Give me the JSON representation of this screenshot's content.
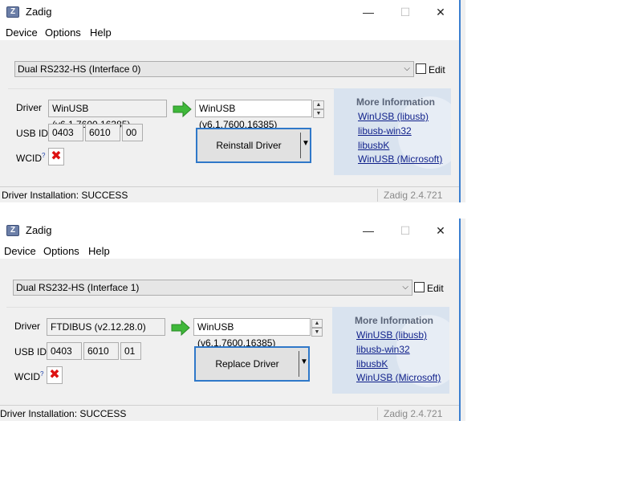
{
  "windows": [
    {
      "title": "Zadig",
      "app_icon_letter": "Z",
      "menu": [
        "Device",
        "Options",
        "Help"
      ],
      "device_selected": "Dual RS232-HS (Interface 0)",
      "edit_label": "Edit",
      "driver_label": "Driver",
      "current_driver": "WinUSB (v6.1.7600.16385)",
      "target_driver": "WinUSB (v6.1.7600.16385)",
      "usbid_label": "USB ID",
      "usb_id": [
        "0403",
        "6010",
        "00"
      ],
      "wcid_label": "WCID",
      "wcid_sup": "?",
      "action_button": "Reinstall Driver",
      "more_info_title": "More Information",
      "links": [
        "WinUSB (libusb)",
        "libusb-win32",
        "libusbK",
        "WinUSB (Microsoft)"
      ],
      "status": "Driver Installation: SUCCESS",
      "version": "Zadig 2.4.721"
    },
    {
      "title": "Zadig",
      "app_icon_letter": "Z",
      "menu": [
        "Device",
        "Options",
        "Help"
      ],
      "device_selected": "Dual RS232-HS (Interface 1)",
      "edit_label": "Edit",
      "driver_label": "Driver",
      "current_driver": "FTDIBUS (v2.12.28.0)",
      "target_driver": "WinUSB (v6.1.7600.16385)",
      "usbid_label": "USB ID",
      "usb_id": [
        "0403",
        "6010",
        "01"
      ],
      "wcid_label": "WCID",
      "wcid_sup": "?",
      "action_button": "Replace Driver",
      "more_info_title": "More Information",
      "links": [
        "WinUSB (libusb)",
        "libusb-win32",
        "libusbK",
        "WinUSB (Microsoft)"
      ],
      "status": "Driver Installation: SUCCESS",
      "version": "Zadig 2.4.721"
    }
  ],
  "colors": {
    "accent": "#2f78c9",
    "link": "#0e1f8a",
    "wcid_x": "#dd1111",
    "info_panel_bg": "#d9e3ef"
  },
  "icons": {
    "arrow": "green-right-arrow-icon",
    "wcid": "red-x-icon"
  }
}
